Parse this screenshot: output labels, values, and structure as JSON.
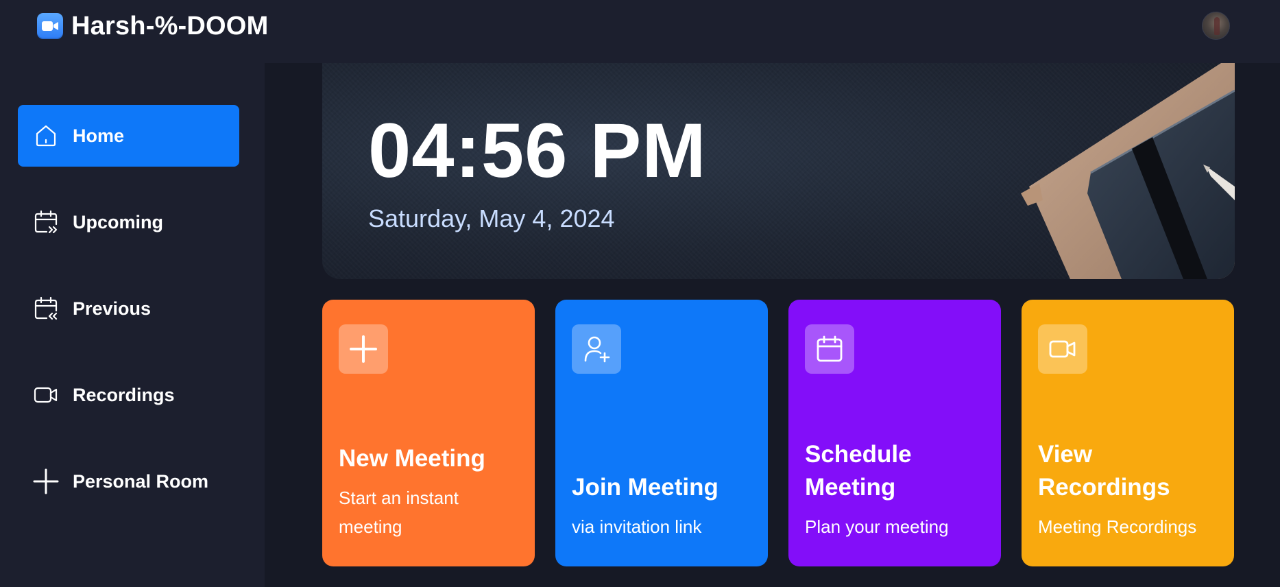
{
  "app": {
    "title": "Harsh-%-DOOM",
    "logo_icon": "video-camera-icon",
    "avatar_icon": "user-avatar"
  },
  "sidebar": {
    "items": [
      {
        "label": "Home",
        "icon": "home-icon",
        "active": true
      },
      {
        "label": "Upcoming",
        "icon": "calendar-forward-icon",
        "active": false
      },
      {
        "label": "Previous",
        "icon": "calendar-back-icon",
        "active": false
      },
      {
        "label": "Recordings",
        "icon": "video-icon",
        "active": false
      },
      {
        "label": "Personal Room",
        "icon": "plus-icon",
        "active": false
      }
    ]
  },
  "hero": {
    "time": "04:56 PM",
    "date": "Saturday, May 4, 2024"
  },
  "cards": [
    {
      "title": "New Meeting",
      "subtitle": "Start an instant meeting",
      "icon": "plus-icon",
      "color": "#ff742e"
    },
    {
      "title": "Join Meeting",
      "subtitle": "via invitation link",
      "icon": "user-add-icon",
      "color": "#0e78f9"
    },
    {
      "title": "Schedule Meeting",
      "subtitle": "Plan your meeting",
      "icon": "calendar-icon",
      "color": "#830ef9"
    },
    {
      "title": "View Recordings",
      "subtitle": "Meeting Recordings",
      "icon": "video-icon",
      "color": "#f9a90e"
    }
  ],
  "colors": {
    "background": "#1c1f2e",
    "main_background": "#161925",
    "accent_blue": "#0e78f9",
    "date_text": "#c9ddff"
  }
}
